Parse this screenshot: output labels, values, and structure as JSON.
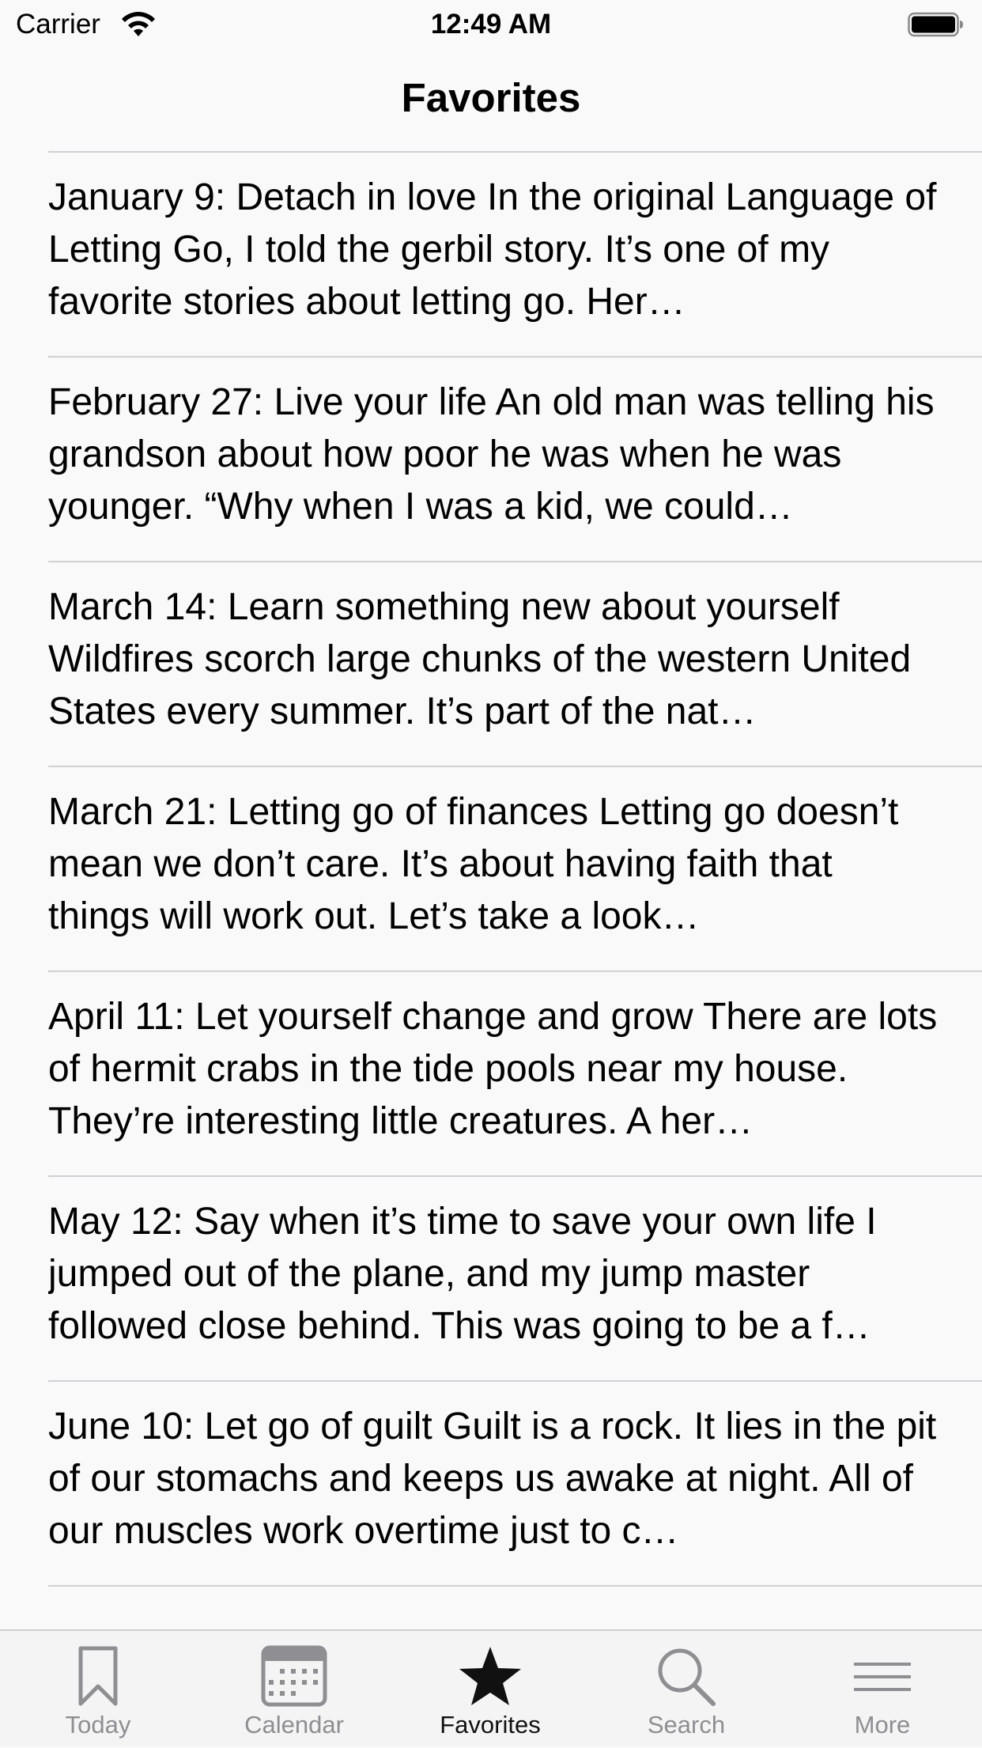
{
  "status_bar": {
    "carrier": "Carrier",
    "time": "12:49 AM"
  },
  "nav": {
    "title": "Favorites"
  },
  "entries": [
    {
      "text": "January 9:  Detach in love In the original Language of Letting Go, I told the gerbil story. It’s one of my favorite stories about letting go. Her…"
    },
    {
      "text": "February 27:  Live your life An old man was telling his grandson about how poor he was when he was younger. “Why when I was a kid, we could…"
    },
    {
      "text": "March 14:  Learn something new about yourself Wildfires scorch large chunks of the western United States every summer. It’s part of the nat…"
    },
    {
      "text": "March 21:  Letting go of finances Letting go doesn’t mean we don’t care. It’s about having faith that things will work out. Let’s take a look…"
    },
    {
      "text": "April 11:  Let yourself change and grow There are lots of hermit crabs in the tide pools near my house. They’re interesting little creatures. A her…"
    },
    {
      "text": "May 12:  Say when it’s time to save your own life I jumped out of the plane, and my jump master followed close behind. This was going to be a f…"
    },
    {
      "text": "June 10:  Let go of guilt Guilt is a rock. It lies in the pit of our stomachs and keeps us awake at night. All of our muscles work overtime just to c…"
    }
  ],
  "tabs": [
    {
      "label": "Today",
      "icon": "bookmark-icon"
    },
    {
      "label": "Calendar",
      "icon": "calendar-icon"
    },
    {
      "label": "Favorites",
      "icon": "star-icon",
      "active": true
    },
    {
      "label": "Search",
      "icon": "search-icon"
    },
    {
      "label": "More",
      "icon": "menu-icon"
    }
  ],
  "colors": {
    "background": "#f9f9f9",
    "separator": "#d0d0d4",
    "tab_inactive": "#8e8e93",
    "tab_active": "#111111"
  }
}
